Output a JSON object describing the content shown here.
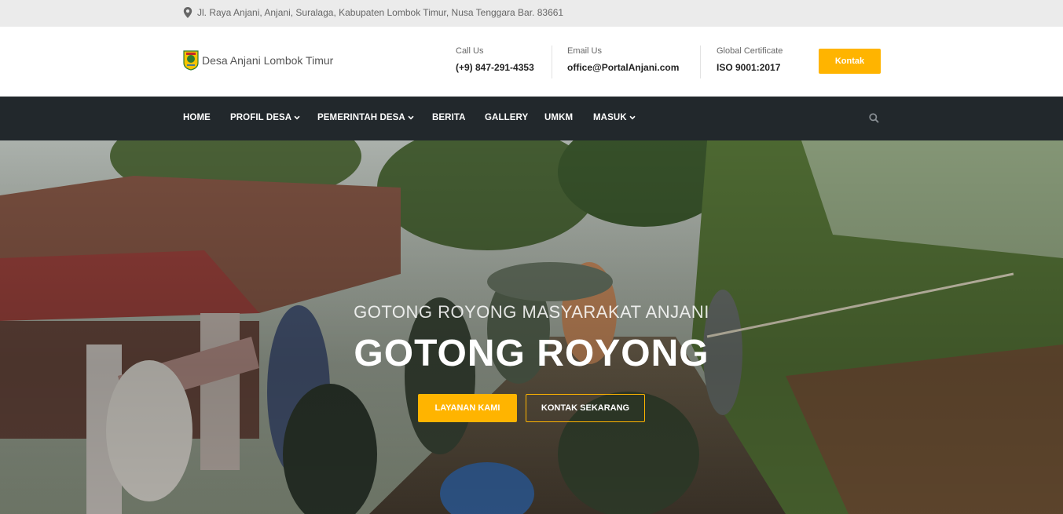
{
  "topbar": {
    "address": "Jl. Raya Anjani, Anjani, Suralaga, Kabupaten Lombok Timur, Nusa Tenggara Bar. 83661",
    "icon": "map-marker-icon"
  },
  "header": {
    "brand_name": "Desa Anjani Lombok Timur",
    "call": {
      "label": "Call Us",
      "value": "(+9) 847-291-4353"
    },
    "email": {
      "label": "Email Us",
      "value": "office@PortalAnjani.com"
    },
    "cert": {
      "label": "Global Certificate",
      "value": "ISO 9001:2017"
    },
    "contact_button": "Kontak"
  },
  "nav": {
    "items": [
      {
        "label": "HOME"
      },
      {
        "label": "PROFIL DESA"
      },
      {
        "label": "PEMERINTAH DESA"
      },
      {
        "label": "BERITA"
      },
      {
        "label": "GALLERY"
      },
      {
        "label": "UMKM"
      },
      {
        "label": "MASUK"
      }
    ],
    "search_icon": "search-icon"
  },
  "hero": {
    "subtitle": "GOTONG ROYONG MASYARAKAT ANJANI",
    "title": "GOTONG ROYONG",
    "primary_button": "LAYANAN KAMI",
    "secondary_button": "KONTAK SEKARANG"
  },
  "colors": {
    "accent": "#ffb400",
    "nav_bg": "#22282c",
    "topbar_bg": "#ebebeb"
  }
}
